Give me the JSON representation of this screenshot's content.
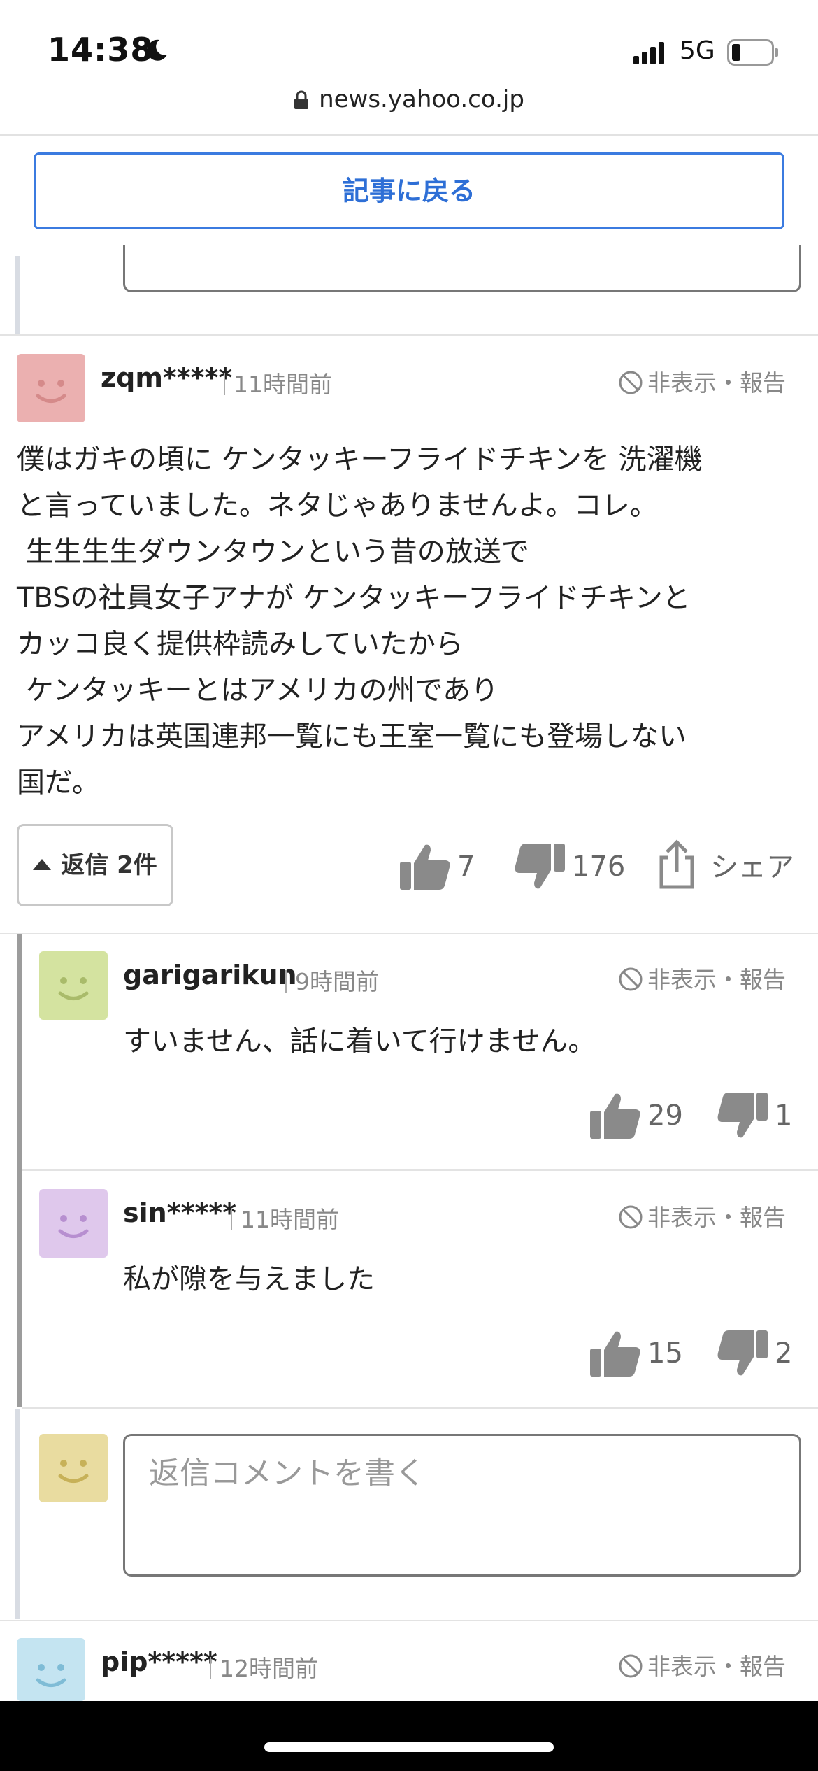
{
  "status_bar": {
    "time": "14:38",
    "network": "5G",
    "battery_icon": "battery-low-icon"
  },
  "browser": {
    "url": "news.yahoo.co.jp"
  },
  "back_button": {
    "label": "記事に戻る"
  },
  "main_comment": {
    "username": "zqm*****",
    "time": "11時間前",
    "actions": "非表示・報告",
    "avatar_color": "#e8a8a8",
    "lines": [
      "僕はガキの頃に ケンタッキーフライドチキンを 洗濯機",
      "と言っていました。ネタじゃありませんよ。コレ。",
      " 生生生生ダウンタウンという昔の放送で",
      "TBSの社員女子アナが ケンタッキーフライドチキンと",
      "カッコ良く提供枠読みしていたから",
      " ケンタッキーとはアメリカの州であり",
      "アメリカは英国連邦一覧にも王室一覧にも登場しない",
      "国だ。"
    ],
    "reply_toggle": "返信 2件",
    "likes": "7",
    "dislikes": "176",
    "share": "シェア"
  },
  "replies": [
    {
      "username": "garigarikun",
      "time": "9時間前",
      "actions": "非表示・報告",
      "text": "すいません、話に着いて行けません。",
      "likes": "29",
      "dislikes": "1",
      "avatar_color": "#cfe09a"
    },
    {
      "username": "sin*****",
      "time": "11時間前",
      "actions": "非表示・報告",
      "text": "私が隙を与えました",
      "likes": "15",
      "dislikes": "2",
      "avatar_color": "#dcc3ea"
    }
  ],
  "reply_box": {
    "placeholder": "返信コメントを書く",
    "avatar_color": "#e7d9a0"
  },
  "next_comment": {
    "username": "pip*****",
    "time": "12時間前",
    "actions": "非表示・報告",
    "avatar_color": "#bfe2f0"
  },
  "colors": {
    "accent": "#2e6fd6",
    "icon_gray": "#8a8a8a"
  }
}
